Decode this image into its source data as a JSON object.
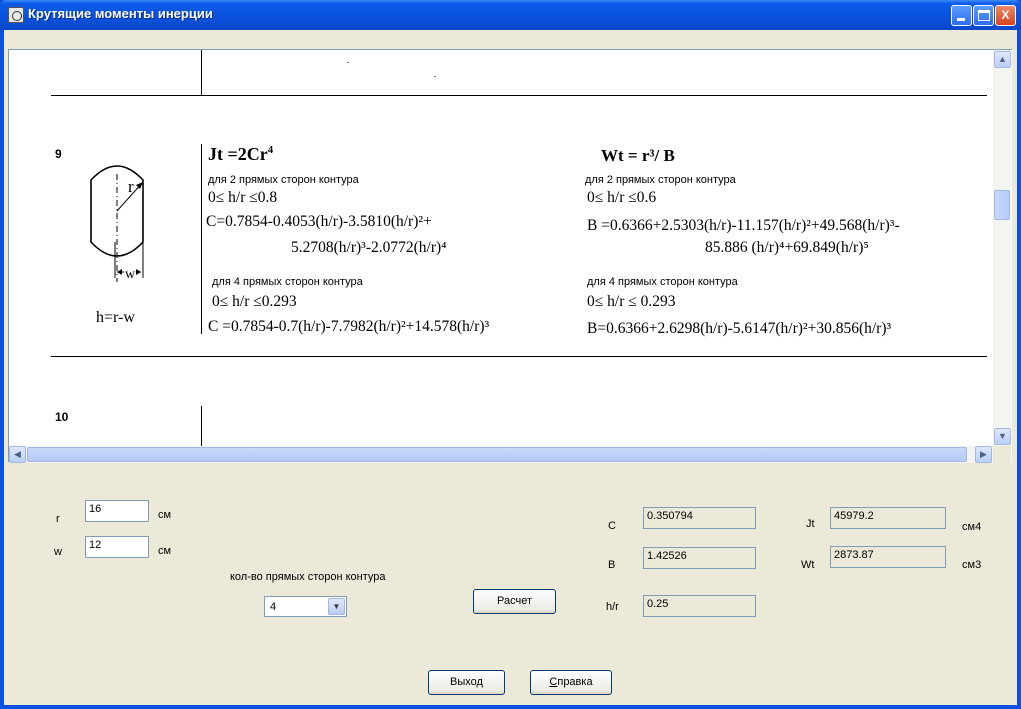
{
  "window": {
    "title": "Крутящие моменты инерции",
    "controls": {
      "minimize": "_",
      "maximize": "□",
      "close": "X"
    }
  },
  "table": {
    "row9": {
      "number": "9",
      "figure": {
        "r_label": "r",
        "w_label": "w",
        "h_formula": "h=r-w"
      },
      "jt_formula": "Jt =2Cr",
      "jt_exp": "4",
      "wt_formula": "Wt = r³/ B",
      "left_case1_title": "для  2 прямых сторон контура",
      "left_case1_range": "0≤ h/r ≤0.8",
      "left_C1_line1": "C=0.7854-0.4053(h/r)-3.5810(h/r)²+",
      "left_C1_line2": "5.2708(h/r)³-2.0772(h/r)⁴",
      "left_case2_title": "для 4  прямых сторон контура",
      "left_case2_range": "0≤ h/r ≤0.293",
      "left_C2": "C =0.7854-0.7(h/r)-7.7982(h/r)²+14.578(h/r)³",
      "right_case1_title": "для  2 прямых сторон контура",
      "right_case1_range": "0≤ h/r ≤0.6",
      "right_B1_line1": "B =0.6366+2.5303(h/r)-11.157(h/r)²+49.568(h/r)³-",
      "right_B1_line2": "85.886 (h/r)⁴+69.849(h/r)⁵",
      "right_case2_title": "для 4  прямых сторон контура",
      "right_case2_range": "0≤ h/r ≤ 0.293",
      "right_B2": "B=0.6366+2.6298(h/r)-5.6147(h/r)²+30.856(h/r)³"
    },
    "row10": {
      "number": "10"
    }
  },
  "form": {
    "r_label": "r",
    "r_value": "16",
    "r_unit": "см",
    "w_label": "w",
    "w_value": "12",
    "w_unit": "см",
    "sides_label": "кол-во прямых сторон контура",
    "sides_value": "4",
    "calc_button": "Расчет",
    "C_label": "C",
    "C_value": "0.350794",
    "B_label": "B",
    "B_value": "1.42526",
    "hr_label": "h/r",
    "hr_value": "0.25",
    "Jt_label": "Jt",
    "Jt_value": "45979.2",
    "Jt_unit": "см4",
    "Wt_label": "Wt",
    "Wt_value": "2873.87",
    "Wt_unit": "см3",
    "exit_button": "Выход",
    "help_button_first": "С",
    "help_button_rest": "правка"
  }
}
